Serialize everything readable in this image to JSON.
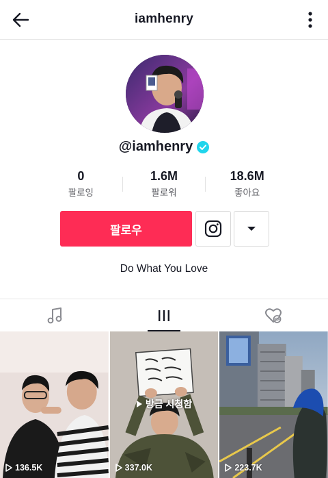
{
  "header": {
    "title": "iamhenry",
    "back_icon": "arrow-left-icon",
    "more_icon": "vertical-dots-icon"
  },
  "profile": {
    "username": "@iamhenry",
    "verified_color": "#20d5ec",
    "bio": "Do What You Love"
  },
  "stats": [
    {
      "value": "0",
      "label": "팔로잉"
    },
    {
      "value": "1.6M",
      "label": "팔로워"
    },
    {
      "value": "18.6M",
      "label": "좋아요"
    }
  ],
  "actions": {
    "follow_label": "팔로우",
    "follow_color": "#fe2c55",
    "instagram_icon": "instagram-icon",
    "dropdown_icon": "caret-down-icon"
  },
  "tabs": [
    {
      "name": "music",
      "icon": "music-note-icon",
      "active": false
    },
    {
      "name": "videos",
      "icon": "grid-bars-icon",
      "active": true
    },
    {
      "name": "liked",
      "icon": "heart-hidden-icon",
      "active": false
    }
  ],
  "videos": [
    {
      "views": "136.5K"
    },
    {
      "views": "337.0K",
      "badge": "방금 시청함"
    },
    {
      "views": "223.7K"
    }
  ]
}
